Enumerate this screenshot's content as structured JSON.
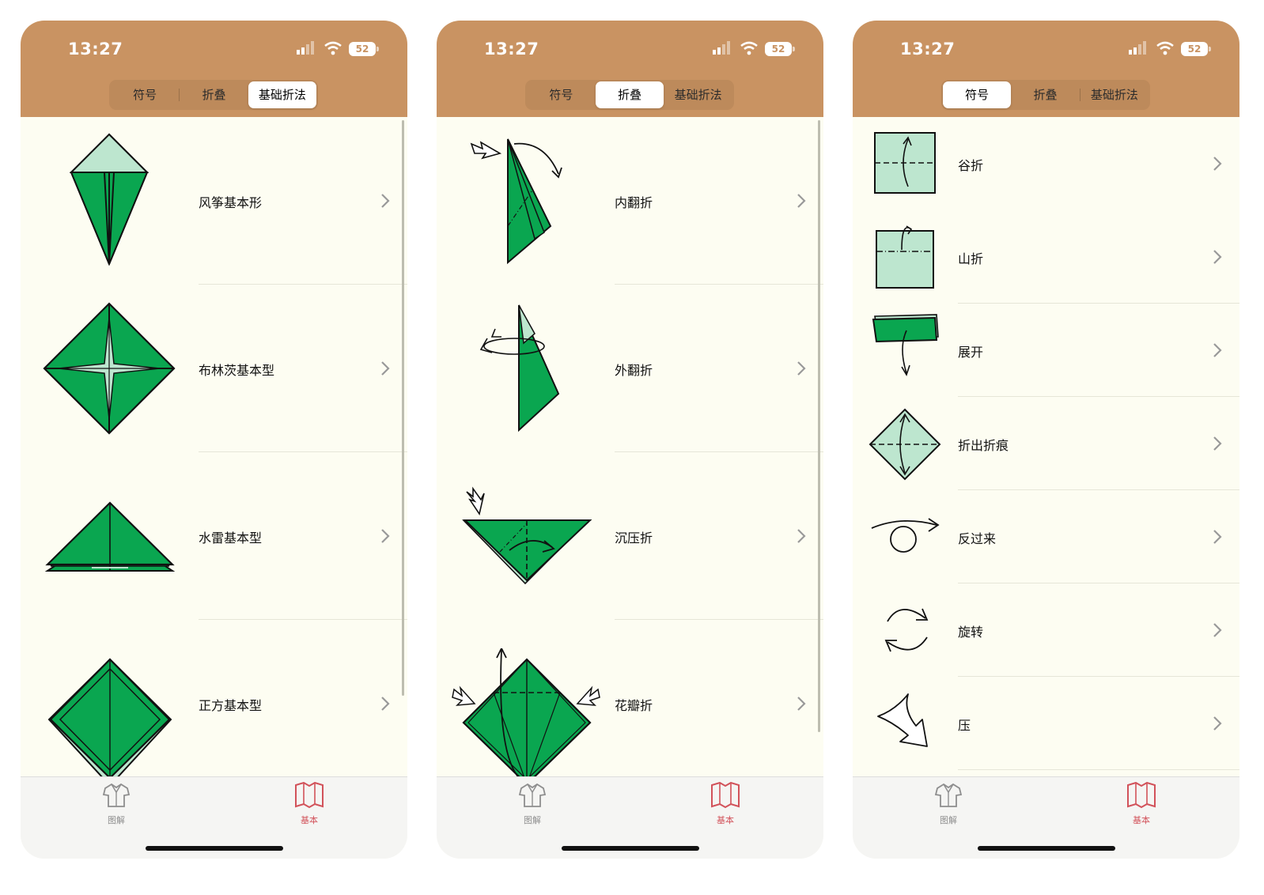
{
  "status": {
    "time": "13:27",
    "battery": "52"
  },
  "segments": [
    "符号",
    "折叠",
    "基础折法"
  ],
  "tabs": {
    "diagram": "图解",
    "basic": "基本"
  },
  "colors": {
    "header": "#c99362",
    "green": "#0aa650",
    "light_green": "#bde6cf",
    "background": "#fdfdf2",
    "active_tab": "#d2525a"
  },
  "screens": [
    {
      "active_segment": "基础折法",
      "items": [
        {
          "label": "风筝基本形",
          "icon": "kite-base-icon"
        },
        {
          "label": "布林茨基本型",
          "icon": "blintz-base-icon"
        },
        {
          "label": "水雷基本型",
          "icon": "waterbomb-base-icon"
        },
        {
          "label": "正方基本型",
          "icon": "square-base-icon"
        }
      ]
    },
    {
      "active_segment": "折叠",
      "items": [
        {
          "label": "内翻折",
          "icon": "inside-reverse-fold-icon"
        },
        {
          "label": "外翻折",
          "icon": "outside-reverse-fold-icon"
        },
        {
          "label": "沉压折",
          "icon": "sink-fold-icon"
        },
        {
          "label": "花瓣折",
          "icon": "petal-fold-icon"
        }
      ]
    },
    {
      "active_segment": "符号",
      "items": [
        {
          "label": "谷折",
          "icon": "valley-fold-icon"
        },
        {
          "label": "山折",
          "icon": "mountain-fold-icon"
        },
        {
          "label": "展开",
          "icon": "unfold-icon"
        },
        {
          "label": "折出折痕",
          "icon": "crease-icon"
        },
        {
          "label": "反过来",
          "icon": "turn-over-icon"
        },
        {
          "label": "旋转",
          "icon": "rotate-icon"
        },
        {
          "label": "压",
          "icon": "press-icon"
        }
      ]
    }
  ]
}
